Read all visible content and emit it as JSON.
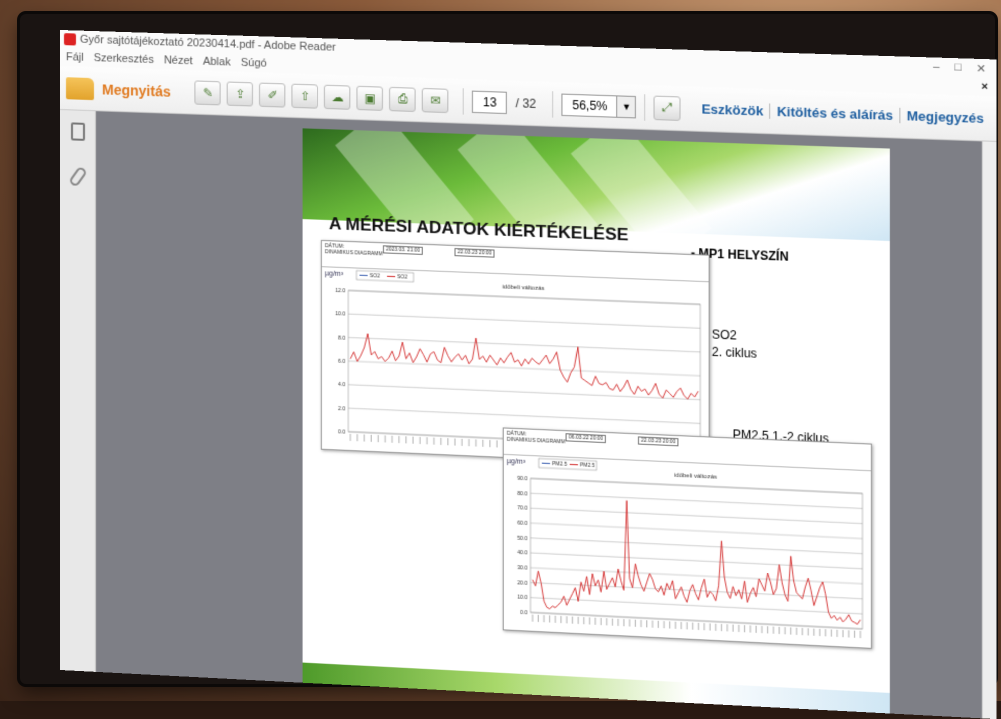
{
  "window": {
    "title": "Győr sajtótájékoztató 20230414.pdf - Adobe Reader",
    "buttons": [
      "–",
      "□",
      "✕"
    ],
    "close_x": "×"
  },
  "menu": [
    "Fájl",
    "Szerkesztés",
    "Nézet",
    "Ablak",
    "Súgó"
  ],
  "toolbar": {
    "open_label": "Megnyitás",
    "page_current": "13",
    "page_total": "/ 32",
    "zoom": "56,5%",
    "zoom_arrow": "▼",
    "links": [
      "Eszközök",
      "Kitöltés és aláírás",
      "Megjegyzés"
    ]
  },
  "slide": {
    "title": "A MÉRÉSI ADATOK KIÉRTÉKELÉSE",
    "location": "- MP1 HELYSZÍN",
    "so2_line1": "SO2",
    "so2_line2": "2. ciklus",
    "pm_label": "PM2.5   1.-2  ciklus"
  },
  "chart_data": [
    {
      "type": "line",
      "title": "időbeli változás",
      "ylabel": "µg/m³",
      "header_r1": "DÁTUM:",
      "header_r2": "DINAMIKUS DIAGRAMM",
      "header_box1": "2023.03.   21:00",
      "header_box2": "22.03.23   20:00",
      "legend": [
        "SO2",
        "SO2"
      ],
      "yticks": [
        "12.0",
        "10.0",
        "8.0",
        "6.0",
        "4.0",
        "2.0",
        "0.0"
      ],
      "ylim": [
        0,
        12
      ],
      "colors": {
        "series_1": "#3a5fb0",
        "series_2": "#d22a2a"
      },
      "series": [
        {
          "name": "SO2",
          "values": [
            6.2,
            6.8,
            6.0,
            6.5,
            7.2,
            8.4,
            6.6,
            6.9,
            6.3,
            6.5,
            6.1,
            6.4,
            7.0,
            6.2,
            6.6,
            7.8,
            6.4,
            6.9,
            6.1,
            6.6,
            7.3,
            6.8,
            6.2,
            6.9,
            7.1,
            6.4,
            6.2,
            7.5,
            6.8,
            6.3,
            6.7,
            7.0,
            6.5,
            6.9,
            6.2,
            6.6,
            8.4,
            6.6,
            6.9,
            6.4,
            7.0,
            6.6,
            6.2,
            6.8,
            6.4,
            6.9,
            7.3,
            6.5,
            6.7,
            6.2,
            6.8,
            6.4,
            6.9,
            6.6,
            6.4,
            6.8,
            7.2,
            6.5,
            6.9,
            7.5,
            6.0,
            5.4,
            5.0,
            5.8,
            6.3,
            8.0,
            5.4,
            5.2,
            5.0,
            4.8,
            5.6,
            5.0,
            4.9,
            5.1,
            4.6,
            4.5,
            5.0,
            4.4,
            4.8,
            5.4,
            4.6,
            4.2,
            4.9,
            4.5,
            4.7,
            4.2,
            4.6,
            5.2,
            4.3,
            4.0,
            4.7,
            4.4,
            4.1,
            4.6,
            4.9,
            4.3,
            4.0,
            4.5,
            4.2,
            4.7
          ]
        }
      ]
    },
    {
      "type": "line",
      "title": "időbeli változás",
      "ylabel": "µg/m³",
      "header_r1": "DÁTUM:",
      "header_r2": "DINAMIKUS DIAGRAMM",
      "header_box1": "06.03.22   20:00",
      "header_box2": "22.03.23   20:00",
      "legend": [
        "PM2.5",
        "PM2.5"
      ],
      "yticks": [
        "90.0",
        "80.0",
        "70.0",
        "60.0",
        "50.0",
        "40.0",
        "30.0",
        "20.0",
        "10.0",
        "0.0"
      ],
      "ylim": [
        0,
        90
      ],
      "colors": {
        "series_1": "#3a5fb0",
        "series_2": "#d22a2a"
      },
      "series": [
        {
          "name": "PM2.5",
          "values": [
            22,
            18,
            28,
            20,
            8,
            4,
            3,
            5,
            4,
            6,
            8,
            12,
            6,
            10,
            14,
            18,
            9,
            22,
            16,
            26,
            14,
            28,
            20,
            24,
            16,
            30,
            18,
            22,
            26,
            20,
            32,
            24,
            18,
            78,
            26,
            20,
            36,
            28,
            22,
            18,
            24,
            30,
            26,
            20,
            18,
            22,
            16,
            24,
            20,
            26,
            14,
            18,
            22,
            16,
            12,
            20,
            24,
            18,
            14,
            22,
            28,
            16,
            20,
            18,
            14,
            24,
            54,
            30,
            20,
            16,
            24,
            18,
            22,
            16,
            28,
            14,
            20,
            24,
            18,
            30,
            26,
            22,
            34,
            28,
            20,
            24,
            40,
            28,
            20,
            16,
            46,
            30,
            22,
            20,
            18,
            26,
            32,
            24,
            14,
            20,
            26,
            30,
            22,
            10,
            6,
            8,
            5,
            7,
            4,
            6,
            9,
            5,
            4,
            3,
            6
          ]
        }
      ]
    }
  ]
}
